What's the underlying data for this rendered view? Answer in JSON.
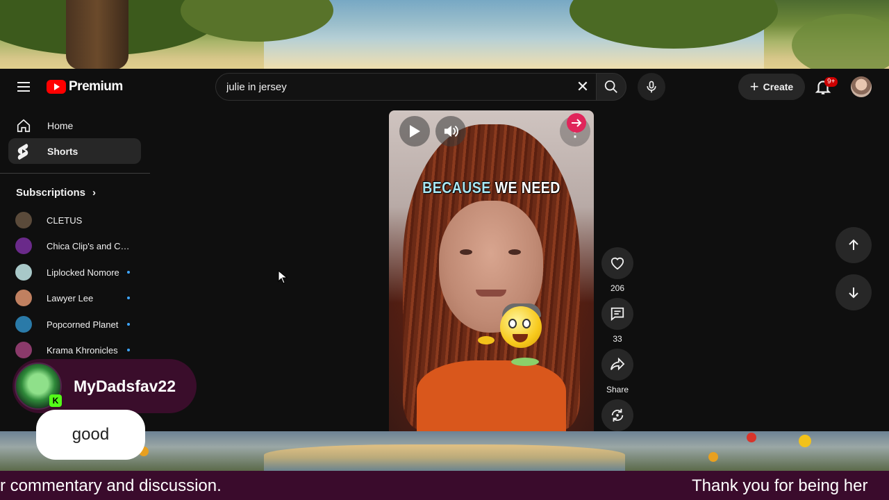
{
  "app": {
    "brand": "Premium"
  },
  "search": {
    "query": "julie in jersey",
    "clear_icon": "close-icon",
    "search_icon": "search-icon",
    "mic_icon": "mic-icon"
  },
  "header": {
    "create_label": "Create",
    "notification_count": "9+"
  },
  "sidebar": {
    "items": [
      {
        "label": "Home",
        "icon": "home-icon",
        "active": false
      },
      {
        "label": "Shorts",
        "icon": "shorts-icon",
        "active": true
      }
    ],
    "subscriptions_title": "Subscriptions",
    "subscriptions": [
      {
        "name": "CLETUS",
        "live": false,
        "color": "#5a4a3a"
      },
      {
        "name": "Chica Clip's and Ch...",
        "live": false,
        "color": "#6a2a8a"
      },
      {
        "name": "Liplocked Nomore",
        "live": true,
        "color": "#a8c8c8"
      },
      {
        "name": "Lawyer Lee",
        "live": true,
        "color": "#c08060"
      },
      {
        "name": "Popcorned Planet",
        "live": true,
        "color": "#2a7aa8"
      },
      {
        "name": "Krama Khronicles",
        "live": true,
        "color": "#8a3a6a"
      }
    ]
  },
  "video": {
    "caption_word1": "BECAUSE",
    "caption_rest": "WE NEED",
    "play_icon": "play-icon",
    "volume_icon": "volume-icon"
  },
  "actions": {
    "like_count": "206",
    "comment_count": "33",
    "share_label": "Share",
    "remix_icon": "remix-icon"
  },
  "overlay": {
    "username": "MyDadsfav22",
    "platform_badge": "K",
    "chat_message": "good",
    "ticker_left": "r commentary and discussion.",
    "ticker_right": "Thank you for being her"
  },
  "colors": {
    "brand_red": "#ff0000",
    "accent_blue": "#3ea6ff",
    "overlay_purple": "#3a0b2c",
    "kick_green": "#53fc18"
  }
}
